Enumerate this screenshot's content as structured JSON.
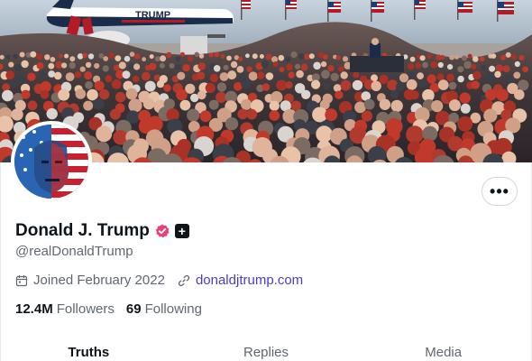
{
  "profile": {
    "display_name": "Donald J. Trump",
    "handle": "@realDonaldTrump",
    "joined": "Joined February 2022",
    "website": "donaldjtrump.com",
    "followers_count": "12.4M",
    "followers_label": "Followers",
    "following_count": "69",
    "following_label": "Following",
    "verified_color": "#e9407a"
  },
  "banner": {
    "plane_text": "TRUMP"
  },
  "actions": {
    "more_label": "•••"
  },
  "tabs": [
    {
      "label": "Truths",
      "active": true
    },
    {
      "label": "Replies",
      "active": false
    },
    {
      "label": "Media",
      "active": false
    }
  ],
  "icons": {
    "calendar": "calendar-icon",
    "link": "link-icon",
    "verified": "verified-badge-icon",
    "plus": "plus-badge-icon",
    "more": "more-icon"
  }
}
